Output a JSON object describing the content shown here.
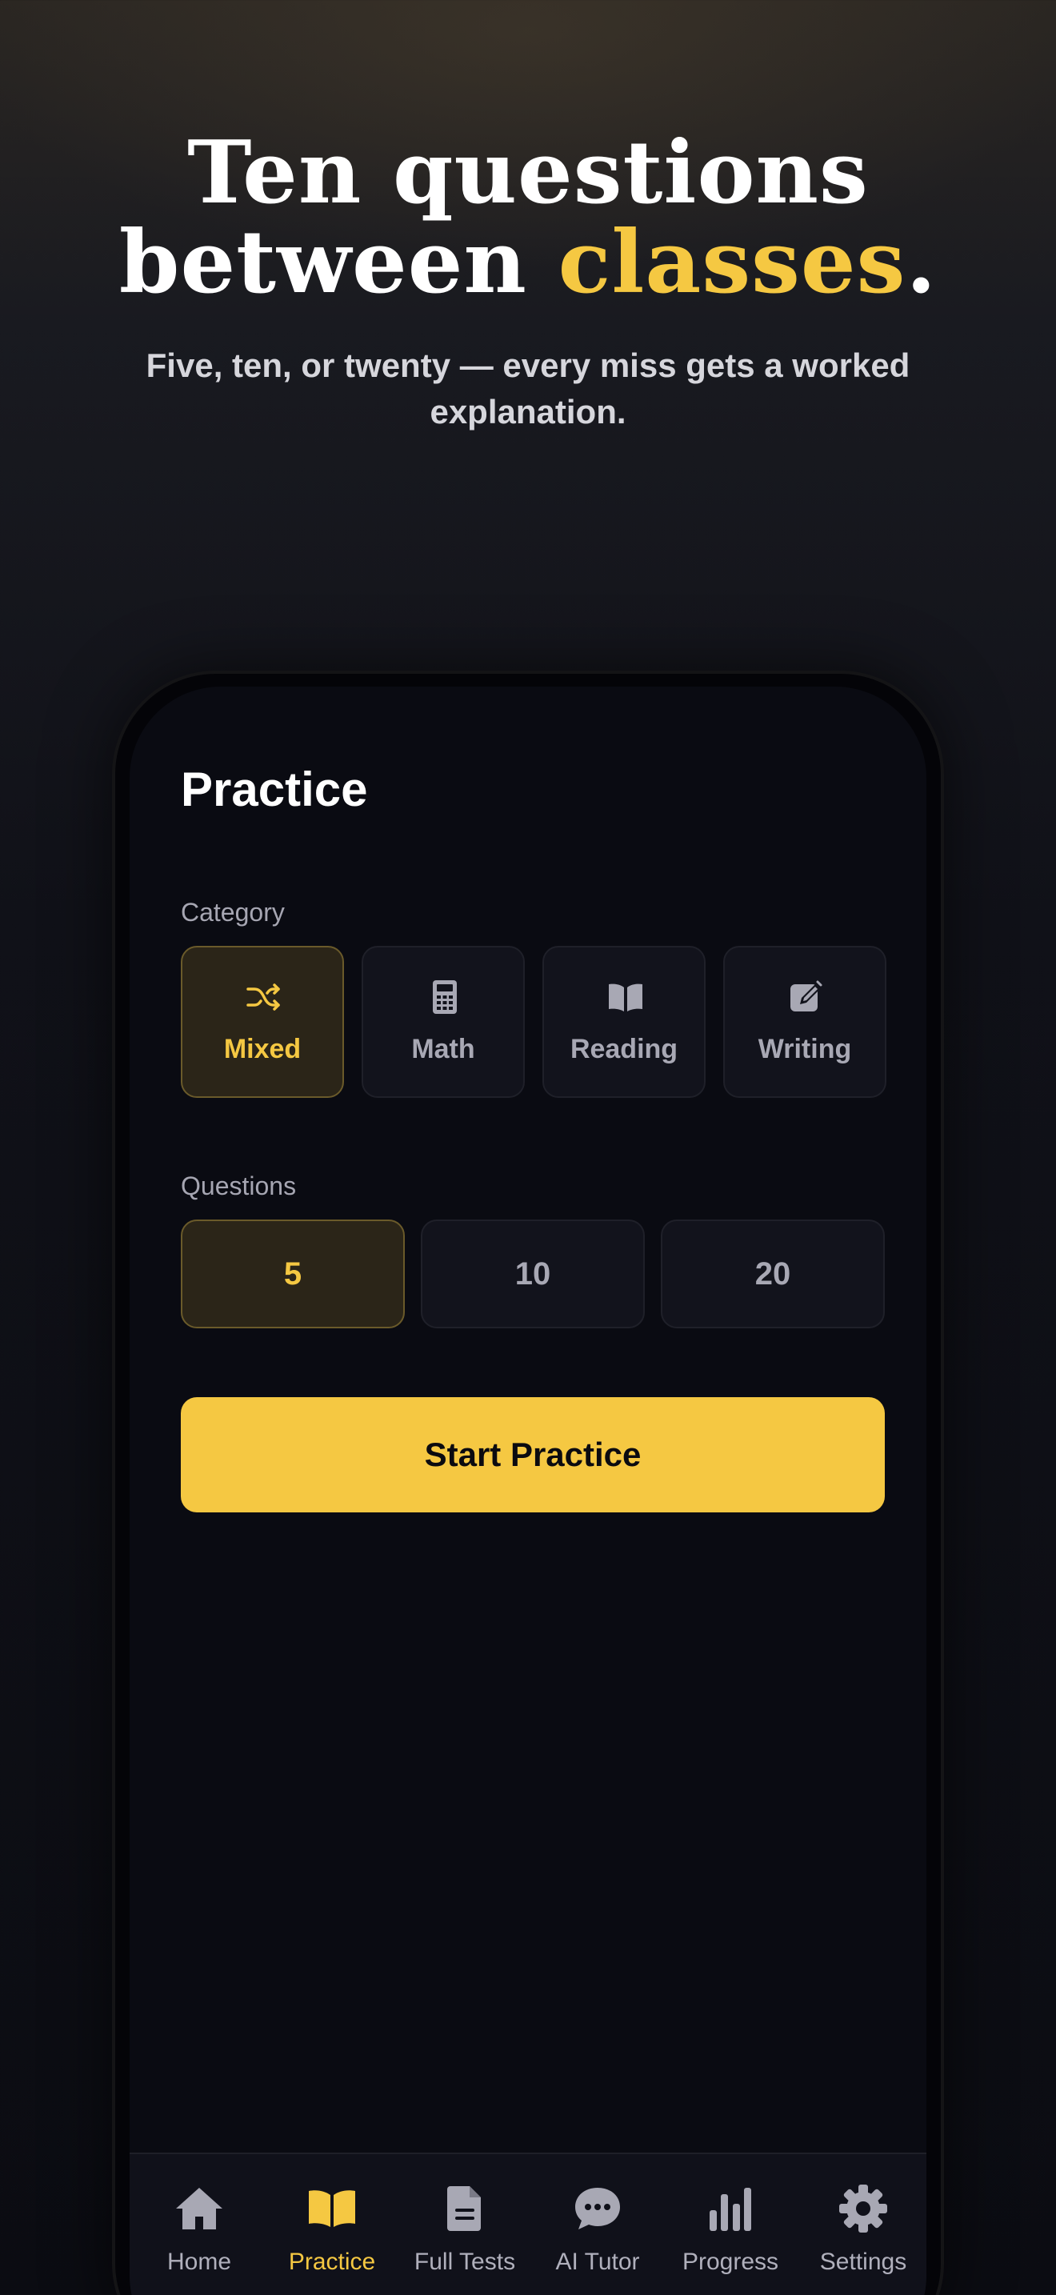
{
  "hero": {
    "title_line1": "Ten questions",
    "title_line2_prefix": "between ",
    "title_line2_accent": "classes",
    "title_line2_suffix": ".",
    "subtitle": "Five, ten, or twenty — every miss gets a worked explanation."
  },
  "screen": {
    "title": "Practice",
    "category_label": "Category",
    "categories": [
      {
        "label": "Mixed",
        "icon": "shuffle-icon",
        "selected": true
      },
      {
        "label": "Math",
        "icon": "calculator-icon",
        "selected": false
      },
      {
        "label": "Reading",
        "icon": "book-open-icon",
        "selected": false
      },
      {
        "label": "Writing",
        "icon": "pen-square-icon",
        "selected": false
      }
    ],
    "questions_label": "Questions",
    "question_counts": [
      {
        "label": "5",
        "selected": true
      },
      {
        "label": "10",
        "selected": false
      },
      {
        "label": "20",
        "selected": false
      }
    ],
    "start_button": "Start Practice"
  },
  "tabbar": {
    "items": [
      {
        "label": "Home",
        "icon": "home-icon",
        "active": false
      },
      {
        "label": "Practice",
        "icon": "book-open-icon",
        "active": true
      },
      {
        "label": "Full Tests",
        "icon": "document-icon",
        "active": false
      },
      {
        "label": "AI Tutor",
        "icon": "chat-bubble-icon",
        "active": false
      },
      {
        "label": "Progress",
        "icon": "bar-chart-icon",
        "active": false
      },
      {
        "label": "Settings",
        "icon": "gear-icon",
        "active": false
      }
    ]
  },
  "colors": {
    "accent": "#f5c842",
    "background": "#0a0b12",
    "muted_text": "#a8a8b4"
  }
}
